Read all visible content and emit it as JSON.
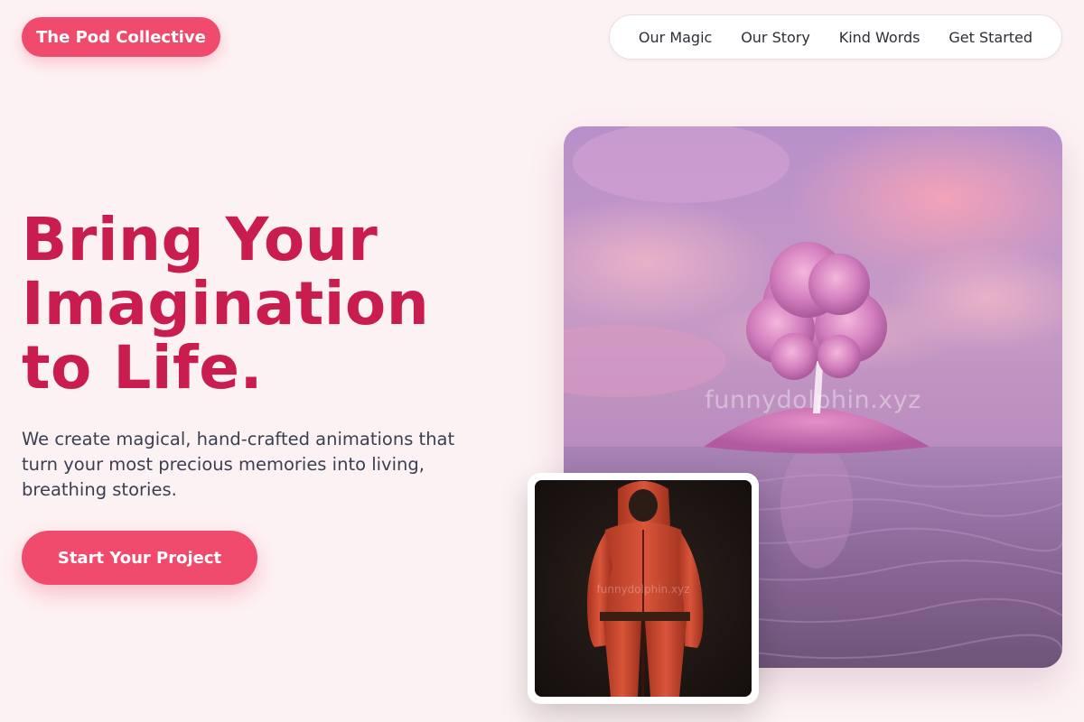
{
  "header": {
    "logo_text": "The Pod Collective",
    "nav_items": [
      "Our Magic",
      "Our Story",
      "Kind Words",
      "Get Started"
    ]
  },
  "hero": {
    "headline_lines": [
      "Bring Your",
      "Imagination",
      "to Life."
    ],
    "subtitle": "We create magical, hand-crafted animations that turn your most precious memories into living, breathing stories.",
    "cta_label": "Start Your Project"
  },
  "media": {
    "main_watermark": "funnydolphin.xyz",
    "thumb_watermark": "funnydolphin.xyz"
  },
  "colors": {
    "background": "#fdf2f3",
    "accent": "#f04b6c",
    "headline": "#c81d4e",
    "body_text": "#3b3f52"
  }
}
